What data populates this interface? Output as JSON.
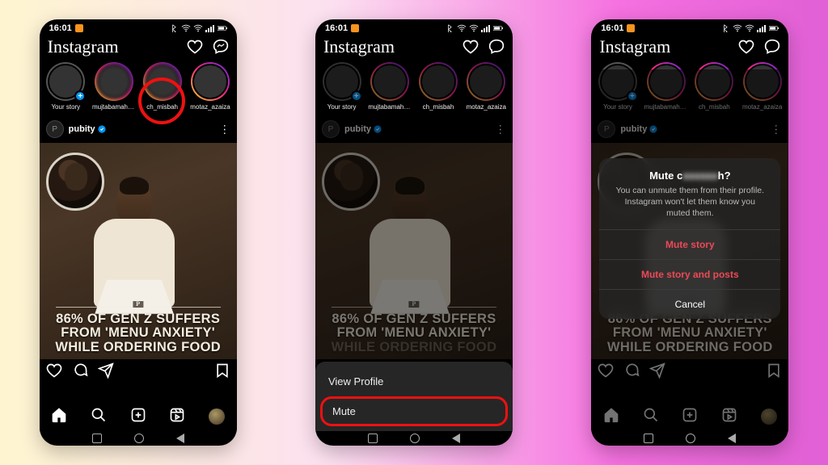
{
  "status": {
    "time": "16:01",
    "icons_text": "⋯",
    "battery": "78"
  },
  "header": {
    "logo": "Instagram"
  },
  "stories": [
    {
      "label": "Your story",
      "avatar_class": "av1",
      "ring": "gray",
      "plus": true
    },
    {
      "label": "mujtabamahbo...",
      "avatar_class": "av2",
      "ring": "grad"
    },
    {
      "label": "ch_misbah",
      "avatar_class": "av3",
      "ring": "grad"
    },
    {
      "label": "motaz_azaiza",
      "avatar_class": "av4",
      "ring": "grad"
    }
  ],
  "post": {
    "author": "pubity",
    "headline_l1": "86% OF GEN Z SUFFERS",
    "headline_l2": "FROM 'MENU ANXIETY'",
    "headline_l3": "WHILE ORDERING FOOD"
  },
  "sheet": {
    "view_profile": "View Profile",
    "mute": "Mute"
  },
  "dialog": {
    "title_prefix": "Mute c",
    "title_suffix": "h?",
    "message": "You can unmute them from their profile. Instagram won't let them know you muted them.",
    "mute_story": "Mute story",
    "mute_story_posts": "Mute story and posts",
    "cancel": "Cancel"
  },
  "annotations": {
    "screen1_story_circle": true,
    "screen2_mute_circle": true
  }
}
